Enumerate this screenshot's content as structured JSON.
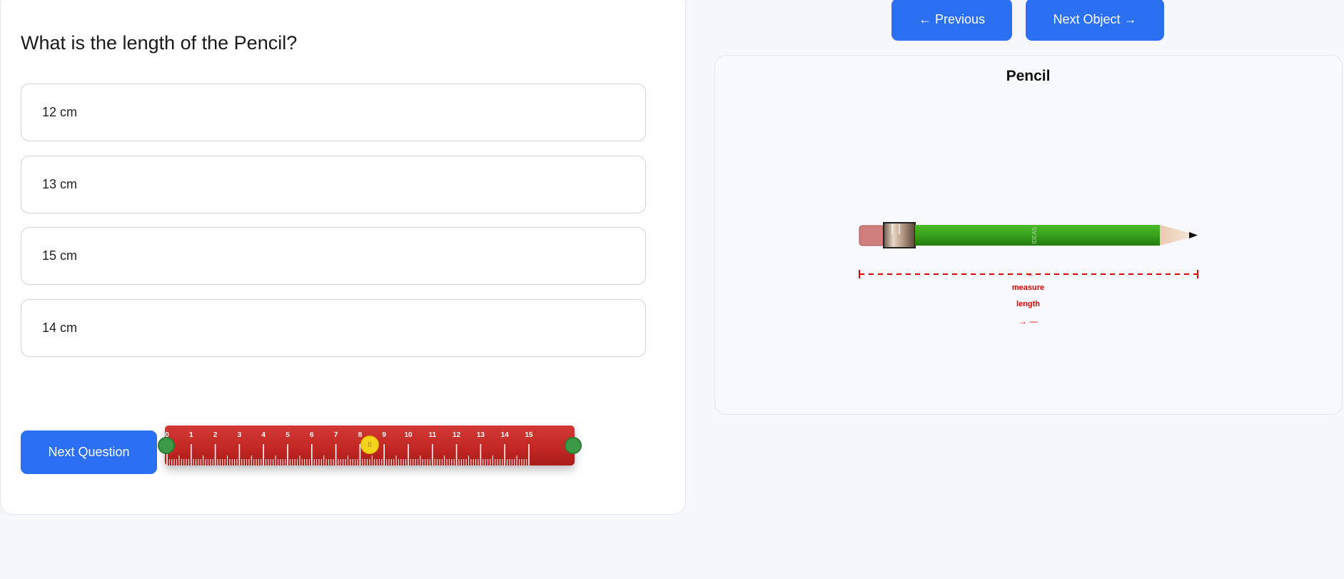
{
  "quiz": {
    "question": "What is the length of the Pencil?",
    "options": [
      {
        "label": "12 cm"
      },
      {
        "label": "13 cm"
      },
      {
        "label": "15 cm"
      },
      {
        "label": "14 cm"
      }
    ],
    "next_question_label": "Next Question"
  },
  "ruler": {
    "tick_labels": [
      "0",
      "1",
      "2",
      "3",
      "4",
      "5",
      "6",
      "7",
      "8",
      "9",
      "10",
      "11",
      "12",
      "13",
      "14",
      "15"
    ],
    "grip_symbol": "⠿",
    "color": "#c62a26",
    "handle_color": "#3a9a45",
    "grip_color": "#f5d31c"
  },
  "navigation": {
    "previous_label": "← Previous",
    "next_object_label": "Next Object →"
  },
  "object": {
    "name": "Pencil",
    "brand_text": "IDEAS",
    "measure_labels": [
      "measure",
      "length",
      "→ —"
    ],
    "pencil_color": "#3aa21f",
    "measure_color": "#e00000"
  },
  "colors": {
    "accent": "#2b6ff2",
    "page_background": "#f6f7fb"
  }
}
